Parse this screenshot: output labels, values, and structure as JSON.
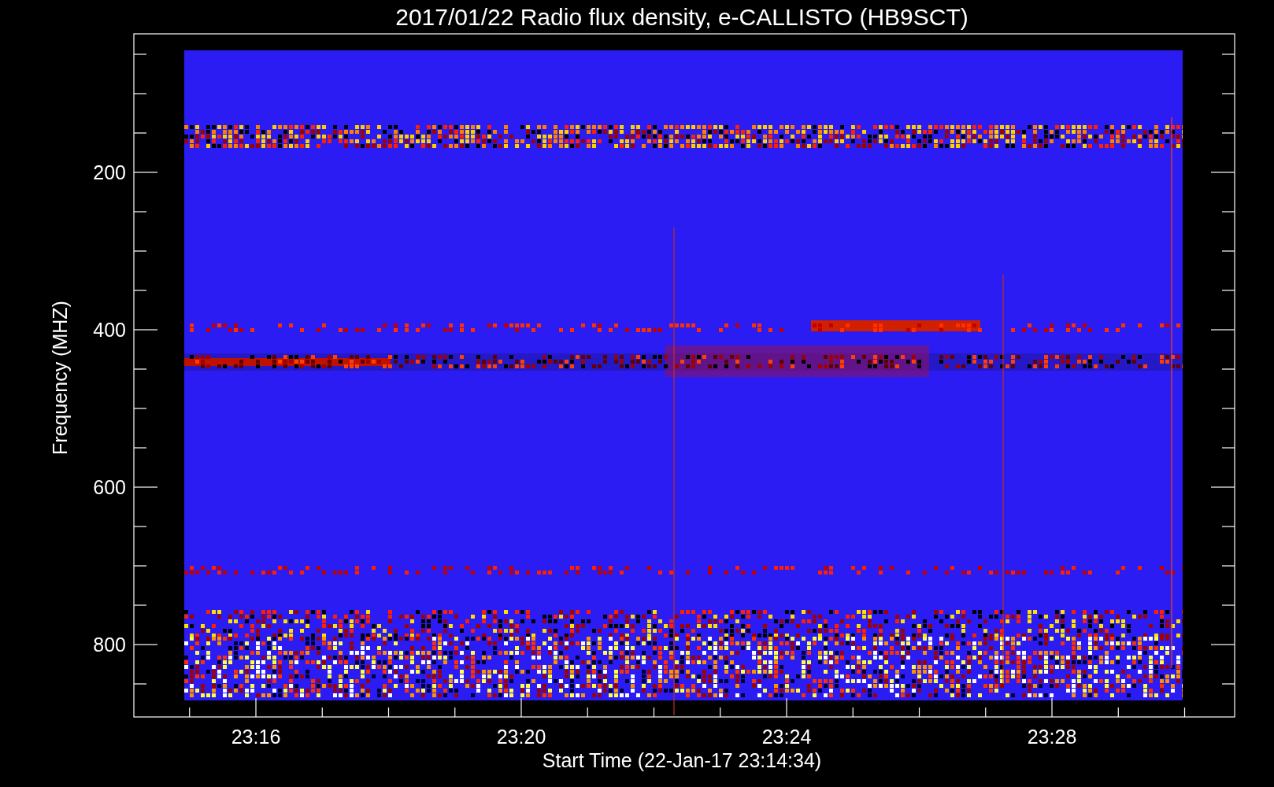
{
  "title": "2017/01/22  Radio flux density, e-CALLISTO (HB9SCT)",
  "y_axis": {
    "label": "Frequency (MHZ)",
    "ticks": [
      "200",
      "400",
      "600",
      "800"
    ]
  },
  "x_axis": {
    "label": "Start Time (22-Jan-17 23:14:34)",
    "ticks": [
      "23:16",
      "23:20",
      "23:24",
      "23:28"
    ]
  }
}
